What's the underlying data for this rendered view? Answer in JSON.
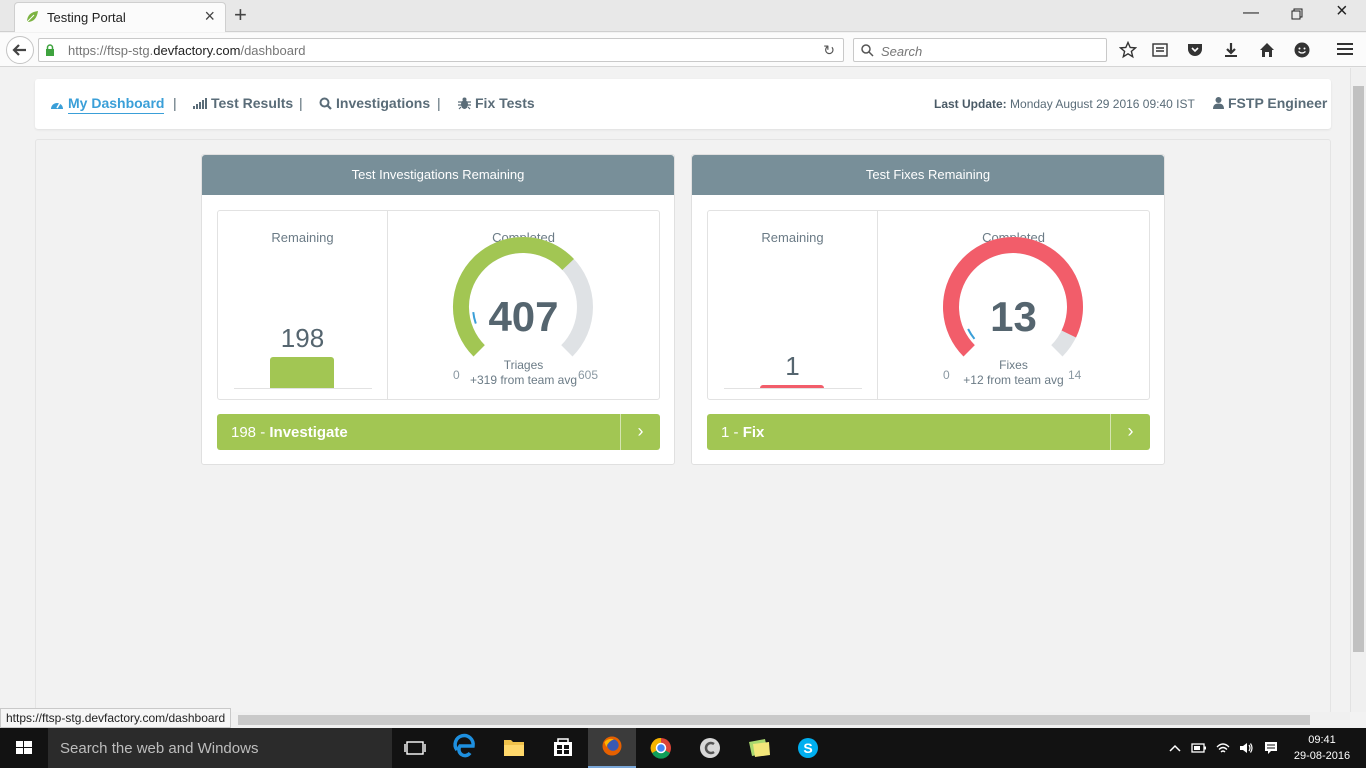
{
  "browser": {
    "tab_title": "Testing Portal",
    "url_prefix": "https://ftsp-stg.",
    "url_domain": "devfactory.com",
    "url_path": "/dashboard",
    "search_placeholder": "Search",
    "status_url": "https://ftsp-stg.devfactory.com/dashboard"
  },
  "nav": {
    "items": [
      {
        "label": "My Dashboard",
        "icon": "dashboard-icon",
        "active": true
      },
      {
        "label": "Test Results",
        "icon": "signal-bars-icon",
        "active": false
      },
      {
        "label": "Investigations",
        "icon": "search-icon",
        "active": false
      },
      {
        "label": "Fix Tests",
        "icon": "bug-icon",
        "active": false
      }
    ],
    "separator": "|",
    "last_update_label": "Last Update:",
    "last_update_value": "Monday August 29 2016 09:40 IST",
    "user_name": "FSTP Engineer"
  },
  "cards": [
    {
      "title": "Test Investigations Remaining",
      "remaining_label": "Remaining",
      "remaining_value": "198",
      "completed_label": "Completed",
      "completed_value": "407",
      "gauge_unit": "Triages",
      "gauge_note": "+319 from team avg",
      "gauge_min": "0",
      "gauge_max": "605",
      "gauge_fraction": 0.673,
      "team_avg_fraction": 0.145,
      "gauge_color": "#a2c653",
      "bar_color": "#a2c653",
      "action_count": "198",
      "action_sep": " - ",
      "action_label": "Investigate"
    },
    {
      "title": "Test Fixes Remaining",
      "remaining_label": "Remaining",
      "remaining_value": "1",
      "completed_label": "Completed",
      "completed_value": "13",
      "gauge_unit": "Fixes",
      "gauge_note": "+12 from team avg",
      "gauge_min": "0",
      "gauge_max": "14",
      "gauge_fraction": 0.929,
      "team_avg_fraction": 0.07,
      "gauge_color": "#f25d6a",
      "bar_color": "#f25d6a",
      "action_count": "1",
      "action_sep": " - ",
      "action_label": "Fix"
    }
  ],
  "taskbar": {
    "search_text": "Search the web and Windows",
    "time": "09:41",
    "date": "29-08-2016"
  },
  "colors": {
    "accent": "#3a9fd8",
    "header_gray": "#788f99",
    "action_green": "#a2c653",
    "gauge_track": "#dfe2e5",
    "team_avg_marker": "#3a9fd8"
  }
}
